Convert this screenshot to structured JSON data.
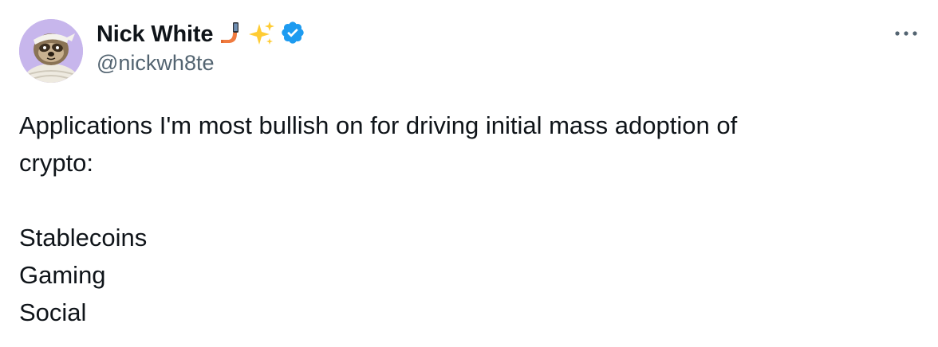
{
  "author": {
    "display_name": "Nick White",
    "handle": "@nickwh8te",
    "emojis": [
      "selfie-phone-icon",
      "sparkles-icon"
    ],
    "verified_color": "#1d9bf0"
  },
  "tweet": {
    "text_line_1": "Applications I'm most bullish on for driving initial mass adoption of",
    "text_line_2": "crypto:",
    "list": [
      "Stablecoins",
      "Gaming",
      "Social"
    ]
  },
  "colors": {
    "text": "#0f1419",
    "secondary": "#536471",
    "verified": "#1d9bf0"
  }
}
